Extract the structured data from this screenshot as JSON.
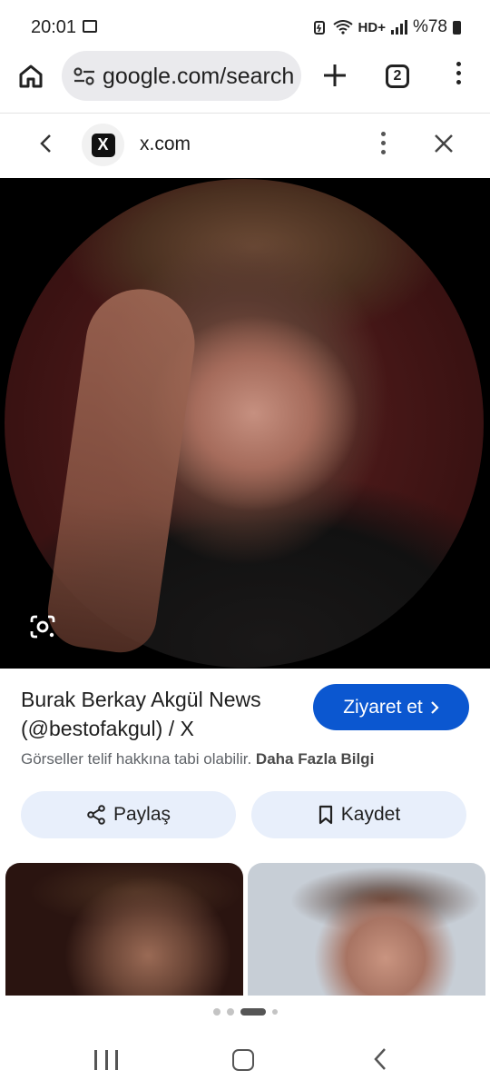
{
  "status_bar": {
    "time": "20:01",
    "network": "HD+",
    "battery": "%78"
  },
  "browser": {
    "url": "google.com/search",
    "tab_count": "2"
  },
  "source": {
    "domain": "x.com",
    "logo_letter": "X"
  },
  "image": {
    "title": "Burak Berkay Akgül News (@bestofakgul) / X",
    "visit_label": "Ziyaret et",
    "copyright_text": "Görseller telif hakkına tabi olabilir.",
    "more_info_label": "Daha Fazla Bilgi"
  },
  "actions": {
    "share_label": "Paylaş",
    "save_label": "Kaydet"
  },
  "pager": {
    "page_count": 4,
    "active_index": 2
  },
  "colors": {
    "accent": "#0b57d0",
    "action_bg": "#e8effb"
  }
}
